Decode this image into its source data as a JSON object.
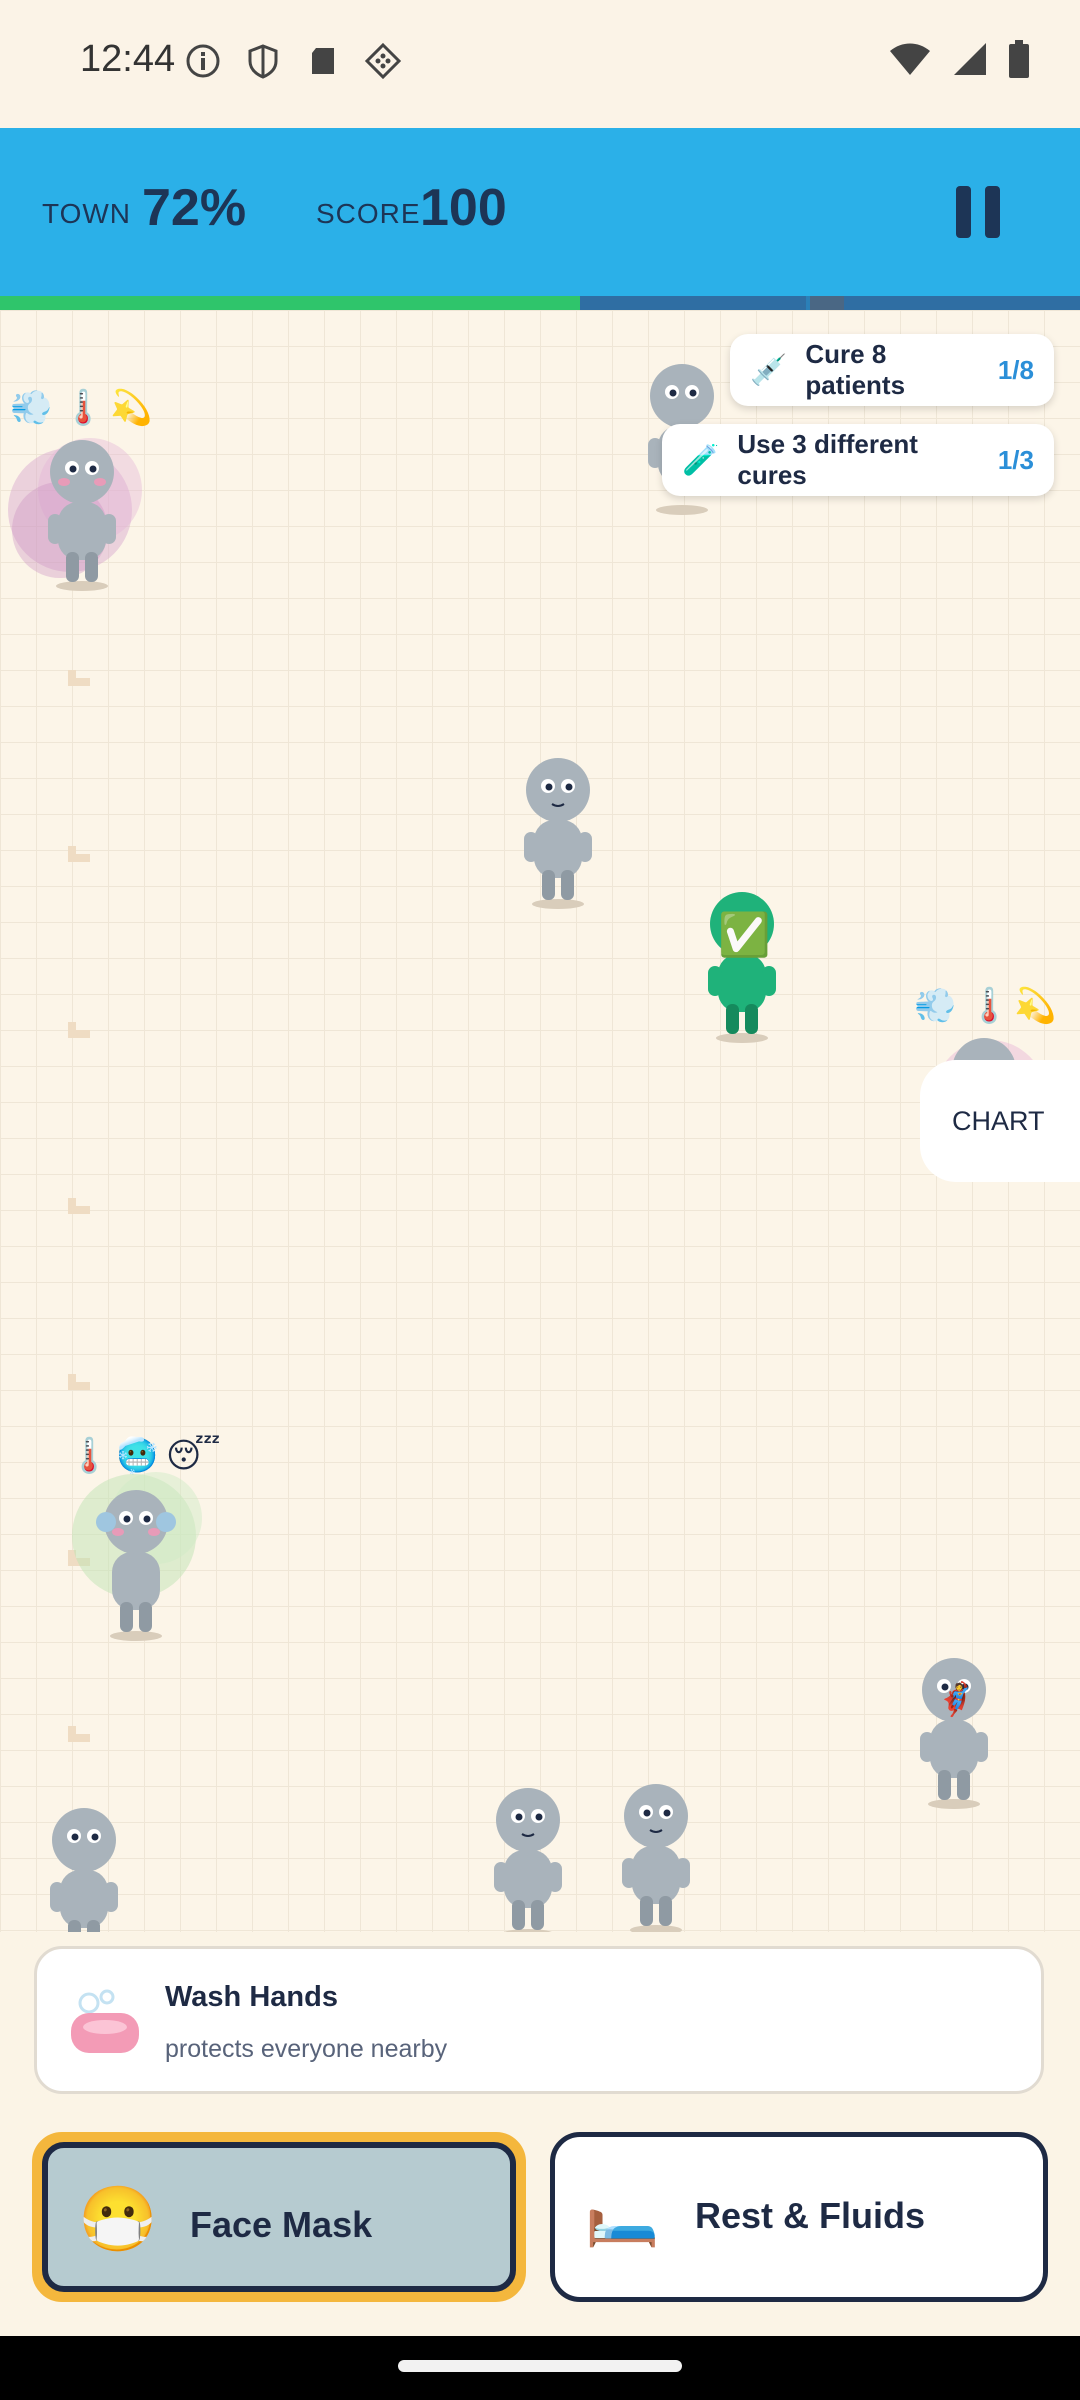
{
  "status_bar": {
    "time": "12:44"
  },
  "hud": {
    "town_label": "TOWN",
    "town_value": "72%",
    "score_label": "SCORE",
    "score_value": "100",
    "town_progress": 0.72
  },
  "goals": [
    {
      "icon": "💉",
      "label": "Cure 8 patients",
      "count": "1/8"
    },
    {
      "icon": "🧪",
      "label": "Use 3 different cures",
      "count": "1/3"
    }
  ],
  "chart_button": {
    "label": "CHART"
  },
  "symptoms": {
    "top_left": [
      "💨",
      "🌡️",
      "💫"
    ],
    "right": [
      "💨",
      "🌡️",
      "💫"
    ],
    "lower_left": [
      "🌡️",
      "🥶",
      "😴"
    ]
  },
  "status_marks": {
    "cured": "✅",
    "hero": "🦸"
  },
  "selected_cure": {
    "icon": "soap-icon",
    "title": "Wash Hands",
    "description": "protects everyone nearby"
  },
  "cures": [
    {
      "icon": "🧼",
      "label": "Face Mask",
      "emoji": "😷",
      "selected": true
    },
    {
      "icon": "🛏️",
      "label": "Rest & Fluids",
      "emoji": "🛏️",
      "selected": false
    }
  ],
  "colors": {
    "header": "#2bb0e8",
    "progress_fill": "#2fc56b",
    "person": "#a9b3bb",
    "cured_person": "#1fb27a",
    "accent_count": "#2b8fd8",
    "selected_outline": "#f4b73d"
  }
}
